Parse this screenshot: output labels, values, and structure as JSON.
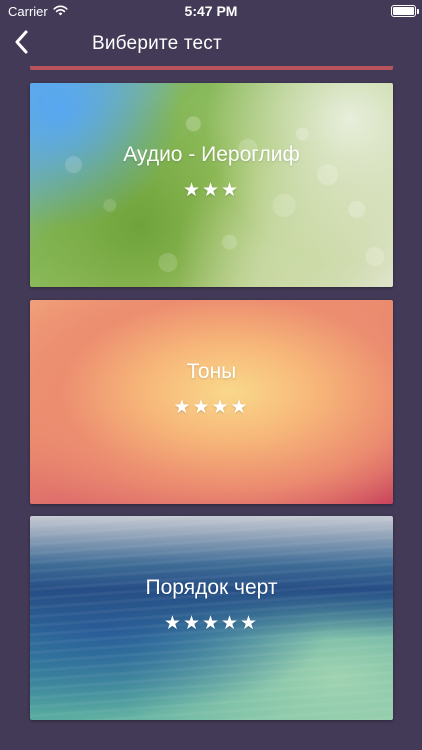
{
  "status_bar": {
    "carrier": "Carrier",
    "time": "5:47 PM"
  },
  "nav": {
    "title": "Виберите тест",
    "back_icon": "chevron-left-icon"
  },
  "tests": [
    {
      "title": "Аудио - Иероглиф",
      "stars": "★★★"
    },
    {
      "title": "Тоны",
      "stars": "★★★★"
    },
    {
      "title": "Порядок черт",
      "stars": "★★★★★"
    }
  ],
  "colors": {
    "background": "#433a57",
    "text": "#ffffff"
  }
}
